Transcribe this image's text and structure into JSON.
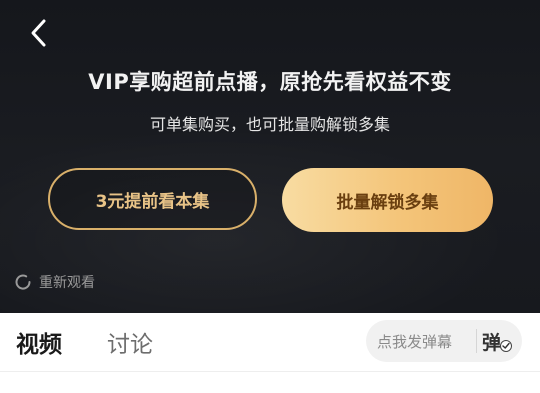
{
  "paywall": {
    "headline": "VIP享购超前点播，原抢先看权益不变",
    "subline": "可单集购买，也可批量购解锁多集",
    "buy_single_label": "3元提前看本集",
    "buy_bulk_label": "批量解锁多集",
    "replay_label": "重新观看",
    "back_icon": "chevron-left-icon",
    "replay_icon": "refresh-icon"
  },
  "tabs": {
    "video_label": "视频",
    "discuss_label": "讨论"
  },
  "danmaku": {
    "placeholder": "点我发弹幕",
    "toggle_char": "弹",
    "toggle_state": "on"
  },
  "colors": {
    "panel_bg": "#17191e",
    "gold_outline": "#d9b06a",
    "gold_text": "#e8c387",
    "gold_fill_start": "#f8dca2",
    "gold_fill_end": "#efb667",
    "gold_button_text": "#6a3f10"
  }
}
